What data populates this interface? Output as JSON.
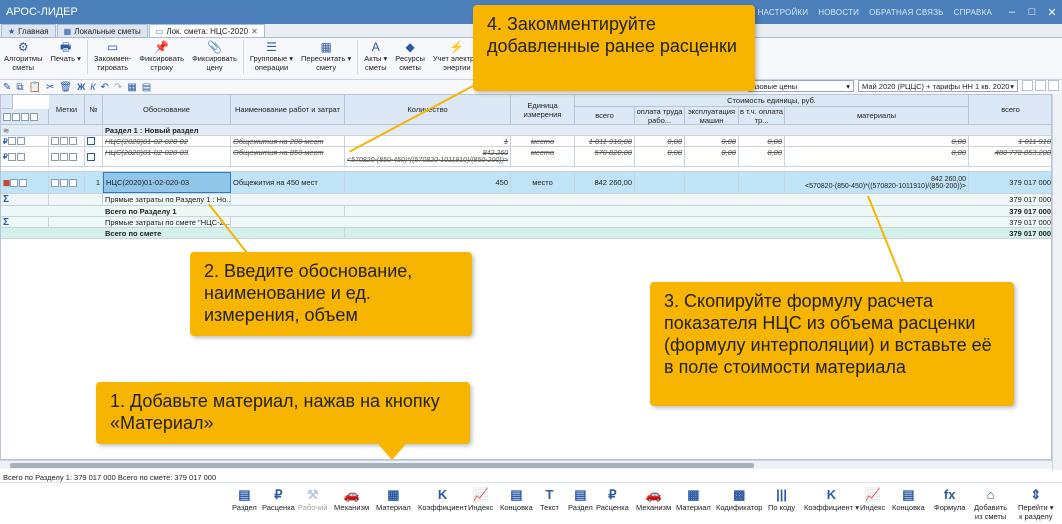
{
  "app": {
    "title": "АРОС-ЛИДЕР",
    "links": [
      "НАСТРОЙКИ",
      "НОВОСТИ",
      "ОБРАТНАЯ СВЯЗЬ",
      "СПРАВКА"
    ]
  },
  "tabs": [
    "Главная",
    "Локальные сметы",
    "Лок. смета: НЦС-2020"
  ],
  "ribbon": [
    {
      "icon": "gear-icon",
      "glyph": "⚙",
      "label": "Алгоритмы\nсметы"
    },
    {
      "icon": "printer-icon",
      "glyph": "🖶",
      "label": "Печать ▾"
    },
    {
      "icon": "comment-icon",
      "glyph": "▭",
      "label": "Закоммен-\nтировать"
    },
    {
      "icon": "pin-icon",
      "glyph": "📌",
      "label": "Фиксировать\nстроку"
    },
    {
      "icon": "clip-icon",
      "glyph": "📎",
      "label": "Фиксировать\nцену"
    },
    {
      "icon": "list-icon",
      "glyph": "☰",
      "label": "Групповые ▾\nоперации"
    },
    {
      "icon": "recalc-icon",
      "glyph": "▦",
      "label": "Пересчитать ▾\nсмету"
    },
    {
      "icon": "acts-icon",
      "glyph": "A",
      "label": "Акты ▾\nсметы"
    },
    {
      "icon": "resources-icon",
      "glyph": "◆",
      "label": "Ресурсы\nсметы"
    },
    {
      "icon": "power-icon",
      "glyph": "⚡",
      "label": "Учет электро-\nэнергии"
    }
  ],
  "combos": {
    "prices": "азовые цены",
    "tariff": "Май 2020 (РЦЦС) + тарифы НН 1 кв. 2020"
  },
  "grid": {
    "headers": {
      "marks": "Метки",
      "num": "№",
      "basis": "Обоснование",
      "name": "Наименование работ и затрат",
      "qty": "Количество",
      "unit": "Единица измерения",
      "unitcost": "Стоимость единицы, руб.",
      "total": "всего",
      "labor": "оплата труда рабо...",
      "machines": "эксплуатация машин",
      "incl": "в т.ч. оплата тр...",
      "materials": "материалы",
      "total2": "всего"
    },
    "section": "Раздел 1 : Новый раздел",
    "rows": [
      {
        "basis": "НЦС(2020)01-02-020-02",
        "name": "Общежития на 200 мест",
        "qty": "1",
        "unit": "место",
        "total": "1 011 910,00",
        "labor": "0,00",
        "machines": "0,00",
        "incl": "0,00",
        "mat": "0,00",
        "sum": "1 011 910"
      },
      {
        "basis": "НЦС(2020)01-02-020-03",
        "name": "Общежития на 850 мест",
        "qty": "842 260",
        "qty2": "<570820-(850-450)*((570820-1011910)/(850-200))>",
        "unit": "место",
        "total": "570 820,00",
        "labor": "0,00",
        "machines": "0,00",
        "incl": "0,00",
        "mat": "0,00",
        "sum": "480 778 853,200"
      },
      {
        "num": "1",
        "basis": "НЦС(2020)01-02-020-03",
        "name": "Общежития на 450 мест",
        "qty": "450",
        "unit": "место",
        "total": "842 260,00",
        "mat": "842 260,00",
        "mat2": "<570820-(850-450)*((570820-1011910)/(850-200))>",
        "sum": "379 017 000"
      }
    ],
    "totals": [
      {
        "label": "Прямые затраты по Разделу 1 : Но...",
        "sum": "379 017 000"
      },
      {
        "label": "Всего по Разделу 1",
        "sum": "379 017 000"
      },
      {
        "label": "Прямые затраты по смете \"НЦС-2...",
        "sum": "379 017 000"
      },
      {
        "label": "Всего по смете",
        "sum": "379 017 000"
      }
    ]
  },
  "status": "Всего по Разделу 1: 379 017 000   Всего по смете: 379 017 000",
  "bottom": [
    {
      "icon": "section-icon",
      "glyph": "▤",
      "label": "Раздел"
    },
    {
      "icon": "ruble-icon",
      "glyph": "₽",
      "label": "Расценка"
    },
    {
      "icon": "worker-icon",
      "glyph": "⚒",
      "label": "Рабочий",
      "dis": true
    },
    {
      "icon": "car-icon",
      "glyph": "🚗",
      "label": "Механизм"
    },
    {
      "icon": "brick-icon",
      "glyph": "▦",
      "label": "Материал"
    },
    {
      "icon": "k-icon",
      "glyph": "K",
      "label": "Коэффициент"
    },
    {
      "icon": "chart-icon",
      "glyph": "📈",
      "label": "Индекс"
    },
    {
      "icon": "ending-icon",
      "glyph": "▤",
      "label": "Концовка"
    },
    {
      "icon": "text-icon",
      "glyph": "T",
      "label": "Текст"
    },
    {
      "icon": "section2-icon",
      "glyph": "▤",
      "label": "Раздел"
    },
    {
      "icon": "ruble2-icon",
      "glyph": "₽",
      "label": "Расценка"
    },
    {
      "icon": "car2-icon",
      "glyph": "🚗",
      "label": "Механизм"
    },
    {
      "icon": "brick2-icon",
      "glyph": "▦",
      "label": "Материал"
    },
    {
      "icon": "codifier-icon",
      "glyph": "▩",
      "label": "Кодификатор"
    },
    {
      "icon": "barcode-icon",
      "glyph": "|||",
      "label": "По коду"
    },
    {
      "icon": "k2-icon",
      "glyph": "K",
      "label": "Коэффициент ▾"
    },
    {
      "icon": "chart2-icon",
      "glyph": "📈",
      "label": "Индекс"
    },
    {
      "icon": "ending2-icon",
      "glyph": "▤",
      "label": "Концовка"
    },
    {
      "icon": "fx-icon",
      "glyph": "fx",
      "label": "Формула"
    },
    {
      "icon": "house-icon",
      "glyph": "⌂",
      "label": "Добавить\nиз сметы"
    },
    {
      "icon": "goto-icon",
      "glyph": "⇕",
      "label": "Перейти ▾\nк разделу"
    }
  ],
  "callouts": {
    "c1": "1. Добавьте материал, нажав на кнопку «Материал»",
    "c2": "2. Введите обоснование, наименование и ед. измерения, объем",
    "c3": "3. Скопируйте формулу расчета показателя НЦС из объема расценки (формулу интерполяции) и вставьте её в поле стоимости материала",
    "c4": "4. Закомментируйте добавленные ранее расценки"
  },
  "colors": {
    "accent": "#f7b500",
    "titlebar": "#4a7fba",
    "header": "#dce8f5",
    "selected": "#bfe3f7"
  }
}
